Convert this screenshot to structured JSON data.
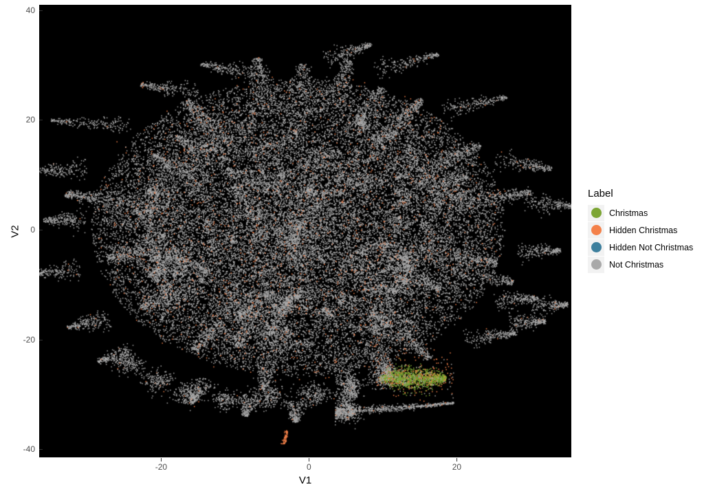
{
  "chart_data": {
    "type": "scatter",
    "title": "",
    "xlabel": "V1",
    "ylabel": "V2",
    "xlim": [
      -36.5,
      35.5
    ],
    "ylim": [
      -41.5,
      41.0
    ],
    "xticks": [
      -20,
      0,
      20
    ],
    "xtick_labels": [
      "-20",
      "0",
      "20"
    ],
    "yticks": [
      40,
      20,
      0,
      -20,
      -40
    ],
    "ytick_labels": [
      "40",
      "20",
      "0",
      "-20",
      "-40"
    ],
    "grid": false,
    "panel_background": "#000000",
    "plot_background": "#ffffff",
    "legend_position": "right",
    "series": [
      {
        "name": "Christmas",
        "color": "#7ca534",
        "approx_count": 620,
        "description": "Tight elongated horizontal cluster isolated at lower right",
        "centroid": [
          12.9,
          -27.0
        ],
        "extent": {
          "x": [
            9.5,
            18.5
          ],
          "y": [
            -28.8,
            -25.5
          ]
        }
      },
      {
        "name": "Hidden Christmas",
        "color": "#f4814a",
        "approx_count": 900,
        "description": "Orange points sprinkled throughout the main cloud plus overlap on the green cluster",
        "centroid": [
          -1.0,
          -1.0
        ],
        "extent": {
          "x": [
            -33.0,
            32.0
          ],
          "y": [
            -39.0,
            33.0
          ]
        }
      },
      {
        "name": "Hidden Not Christmas",
        "color": "#3d7f9d",
        "approx_count": 0,
        "description": "Legend entry only; no visible points in panel",
        "centroid": [
          null,
          null
        ],
        "extent": {
          "x": [
            null,
            null
          ],
          "y": [
            null,
            null
          ]
        }
      },
      {
        "name": "Not Christmas",
        "color": "#a9a9a9",
        "approx_count": 42000,
        "description": "Dense gray radial blob with filamentary spokes filling most of the panel",
        "centroid": [
          -1.5,
          0.5
        ],
        "extent": {
          "x": [
            -34.0,
            33.0
          ],
          "y": [
            -35.0,
            34.0
          ]
        }
      }
    ],
    "structure_notes": {
      "main_cloud_center": [
        -1.5,
        0.5
      ],
      "main_cloud_radius": 28,
      "isolated_features": [
        {
          "name": "green-christmas-streak",
          "x": [
            9.5,
            18.5
          ],
          "y": [
            -28.5,
            -26.0
          ]
        },
        {
          "name": "lower-arc-filament",
          "x": [
            3.5,
            19.5
          ],
          "y": [
            -33.5,
            -31.5
          ]
        },
        {
          "name": "bottom-orange-spur",
          "x": [
            -3.5,
            -3.0
          ],
          "y": [
            -39.0,
            -36.5
          ]
        },
        {
          "name": "top-spoke",
          "x": [
            2.0,
            10.0
          ],
          "y": [
            30.0,
            34.0
          ]
        }
      ]
    }
  },
  "legend": {
    "title": "Label",
    "items": [
      {
        "label": "Christmas",
        "color": "#7ca534"
      },
      {
        "label": "Hidden Christmas",
        "color": "#f4814a"
      },
      {
        "label": "Hidden Not Christmas",
        "color": "#3d7f9d"
      },
      {
        "label": "Not Christmas",
        "color": "#a9a9a9"
      }
    ]
  },
  "axes": {
    "x_title": "V1",
    "y_title": "V2",
    "x_tick_labels": [
      "-20",
      "0",
      "20"
    ],
    "y_tick_labels": [
      "40",
      "20",
      "0",
      "-20",
      "-40"
    ]
  }
}
